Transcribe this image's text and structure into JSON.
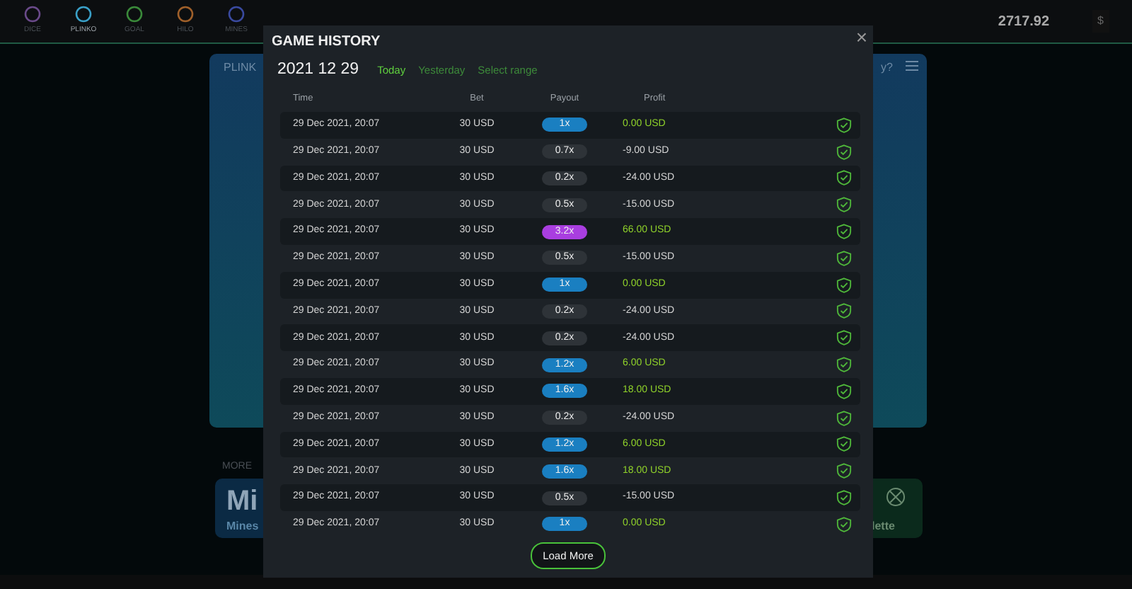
{
  "nav": {
    "items": [
      {
        "label": "DICE",
        "selected": false,
        "color": "#6a4a8a"
      },
      {
        "label": "PLINKO",
        "selected": true,
        "color": "#3aa0c8"
      },
      {
        "label": "GOAL",
        "selected": false,
        "color": "#3a8a3a"
      },
      {
        "label": "HILO",
        "selected": false,
        "color": "#a0602a"
      },
      {
        "label": "MINES",
        "selected": false,
        "color": "#3a4aa0"
      }
    ],
    "balance": "2717.92",
    "currency": "$"
  },
  "game": {
    "title": "PLINK",
    "question": "y?",
    "more_title": "MORE",
    "cards": [
      {
        "title": "Mi",
        "subtitle": "Mines"
      },
      {
        "subtitle": "lette"
      }
    ]
  },
  "modal": {
    "title": "GAME HISTORY",
    "close": "×",
    "date": "2021 12 29",
    "filters": [
      {
        "label": "Today",
        "selected": true
      },
      {
        "label": "Yesterday",
        "selected": false
      },
      {
        "label": "Select range",
        "selected": false
      }
    ],
    "columns": [
      "Time",
      "Bet",
      "Payout",
      "Profit"
    ],
    "rows": [
      {
        "time": "29 Dec 2021, 20:07",
        "bet": "30 USD",
        "payout": "1x",
        "color": "#1a7fc1",
        "profit": "0.00 USD",
        "win": true
      },
      {
        "time": "29 Dec 2021, 20:07",
        "bet": "30 USD",
        "payout": "0.7x",
        "color": "#2e3338",
        "profit": "-9.00 USD",
        "win": false
      },
      {
        "time": "29 Dec 2021, 20:07",
        "bet": "30 USD",
        "payout": "0.2x",
        "color": "#2e3338",
        "profit": "-24.00 USD",
        "win": false
      },
      {
        "time": "29 Dec 2021, 20:07",
        "bet": "30 USD",
        "payout": "0.5x",
        "color": "#2e3338",
        "profit": "-15.00 USD",
        "win": false
      },
      {
        "time": "29 Dec 2021, 20:07",
        "bet": "30 USD",
        "payout": "3.2x",
        "color": "#a93ee0",
        "profit": "66.00 USD",
        "win": true
      },
      {
        "time": "29 Dec 2021, 20:07",
        "bet": "30 USD",
        "payout": "0.5x",
        "color": "#2e3338",
        "profit": "-15.00 USD",
        "win": false
      },
      {
        "time": "29 Dec 2021, 20:07",
        "bet": "30 USD",
        "payout": "1x",
        "color": "#1a7fc1",
        "profit": "0.00 USD",
        "win": true
      },
      {
        "time": "29 Dec 2021, 20:07",
        "bet": "30 USD",
        "payout": "0.2x",
        "color": "#2e3338",
        "profit": "-24.00 USD",
        "win": false
      },
      {
        "time": "29 Dec 2021, 20:07",
        "bet": "30 USD",
        "payout": "0.2x",
        "color": "#2e3338",
        "profit": "-24.00 USD",
        "win": false
      },
      {
        "time": "29 Dec 2021, 20:07",
        "bet": "30 USD",
        "payout": "1.2x",
        "color": "#1a7fc1",
        "profit": "6.00 USD",
        "win": true
      },
      {
        "time": "29 Dec 2021, 20:07",
        "bet": "30 USD",
        "payout": "1.6x",
        "color": "#1a7fc1",
        "profit": "18.00 USD",
        "win": true
      },
      {
        "time": "29 Dec 2021, 20:07",
        "bet": "30 USD",
        "payout": "0.2x",
        "color": "#2e3338",
        "profit": "-24.00 USD",
        "win": false
      },
      {
        "time": "29 Dec 2021, 20:07",
        "bet": "30 USD",
        "payout": "1.2x",
        "color": "#1a7fc1",
        "profit": "6.00 USD",
        "win": true
      },
      {
        "time": "29 Dec 2021, 20:07",
        "bet": "30 USD",
        "payout": "1.6x",
        "color": "#1a7fc1",
        "profit": "18.00 USD",
        "win": true
      },
      {
        "time": "29 Dec 2021, 20:07",
        "bet": "30 USD",
        "payout": "0.5x",
        "color": "#2e3338",
        "profit": "-15.00 USD",
        "win": false
      },
      {
        "time": "29 Dec 2021, 20:07",
        "bet": "30 USD",
        "payout": "1x",
        "color": "#1a7fc1",
        "profit": "0.00 USD",
        "win": true
      }
    ],
    "load_more": "Load More"
  }
}
